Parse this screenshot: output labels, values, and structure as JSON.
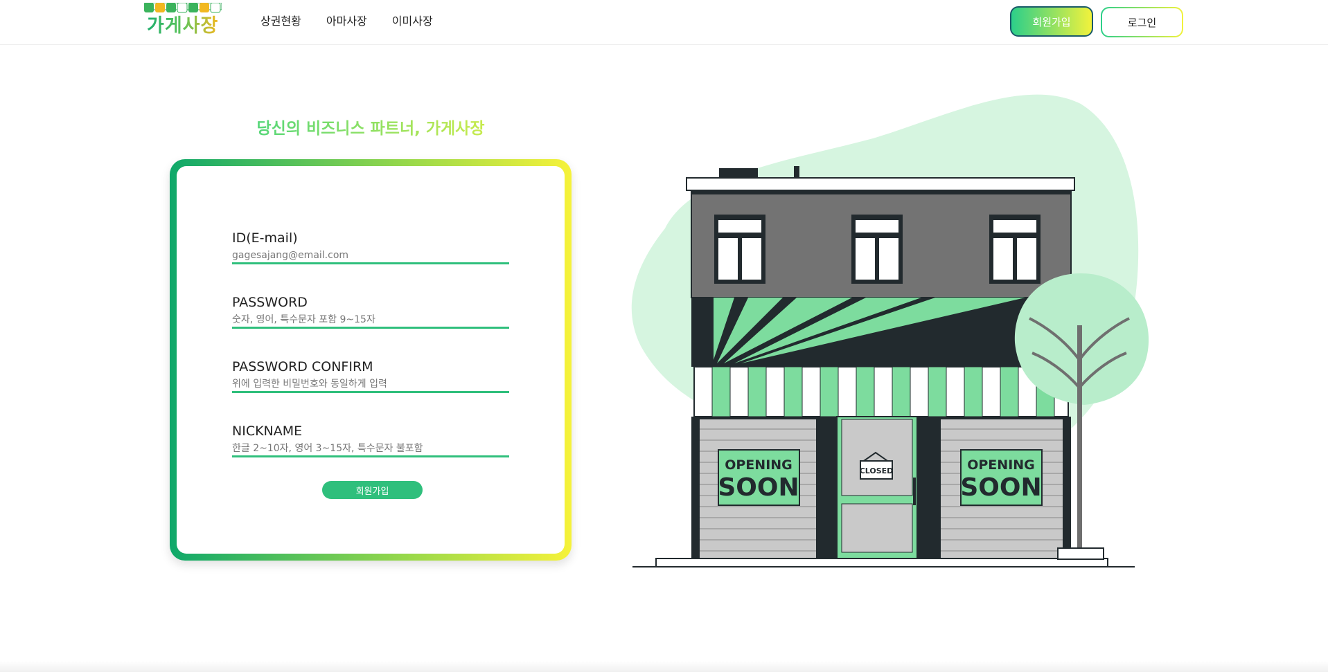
{
  "header": {
    "logo_text": "가게사장",
    "nav": [
      {
        "label": "상권현황"
      },
      {
        "label": "아마사장"
      },
      {
        "label": "이미사장"
      }
    ],
    "signup_label": "회원가입",
    "login_label": "로그인"
  },
  "main": {
    "tagline": "당신의 비즈니스 파트너, 가게사장",
    "form": {
      "fields": [
        {
          "label": "ID(E-mail)",
          "placeholder": "gagesajang@email.com"
        },
        {
          "label": "PASSWORD",
          "placeholder": "숫자, 영어, 특수문자 포함 9~15자"
        },
        {
          "label": "PASSWORD CONFIRM",
          "placeholder": "위에 입력한 비밀번호와 동일하게 입력"
        },
        {
          "label": "NICKNAME",
          "placeholder": "한글 2~10자, 영어 3~15자, 특수문자 불포함"
        }
      ],
      "submit_label": "회원가입"
    },
    "illustration": {
      "sign_left_line1": "OPENING",
      "sign_left_line2": "SOON",
      "sign_right_line1": "OPENING",
      "sign_right_line2": "SOON",
      "door_sign": "CLOSED"
    }
  },
  "colors": {
    "accent_green": "#2fbf7c",
    "accent_yellow": "#f6f23a",
    "dark": "#222a2e",
    "mint": "#7ddc9e"
  }
}
